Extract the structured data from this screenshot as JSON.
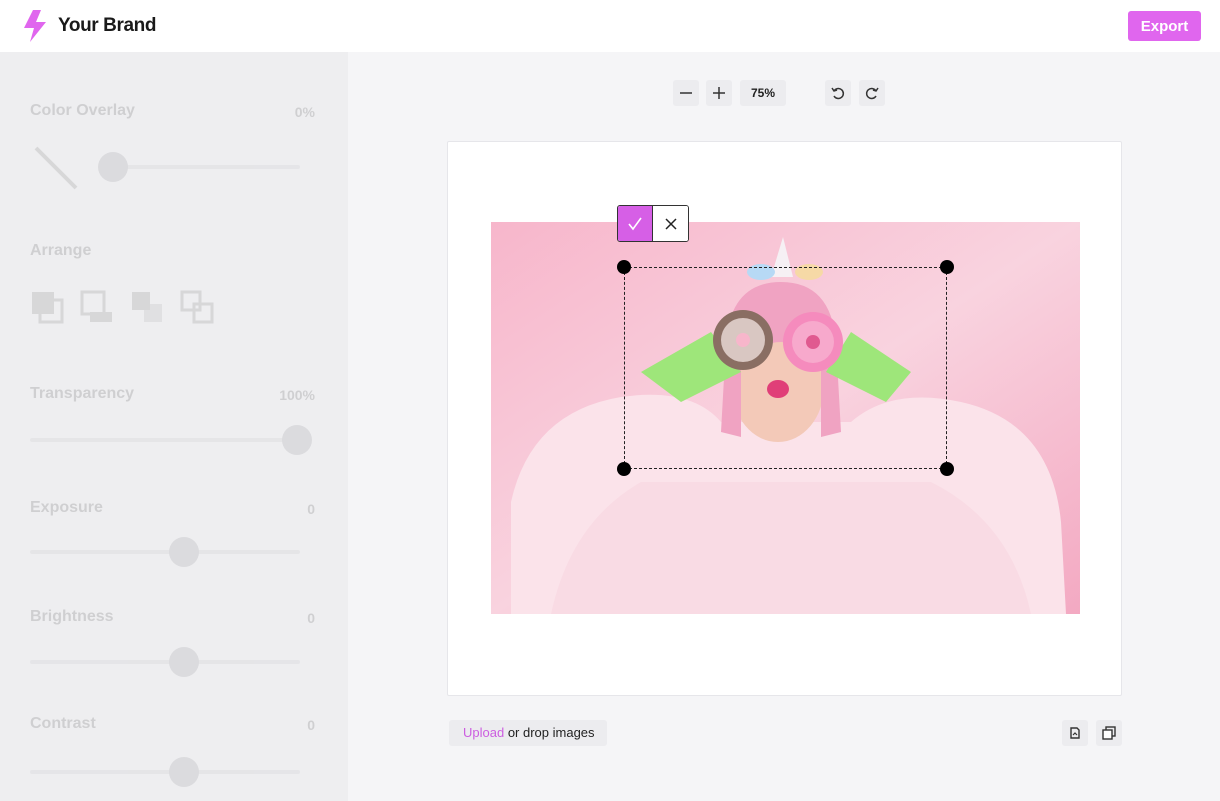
{
  "header": {
    "brand_name": "Your Brand",
    "export_label": "Export",
    "accent_color": "#e066ee"
  },
  "sidebar": {
    "color_overlay": {
      "label": "Color Overlay",
      "value": "0%"
    },
    "arrange": {
      "label": "Arrange",
      "icons": [
        "bring-to-front-icon",
        "send-to-back-icon",
        "bring-forward-icon",
        "send-backward-icon"
      ]
    },
    "transparency": {
      "label": "Transparency",
      "value": "100%"
    },
    "exposure": {
      "label": "Exposure",
      "value": "0"
    },
    "brightness": {
      "label": "Brightness",
      "value": "0"
    },
    "contrast": {
      "label": "Contrast",
      "value": "0"
    }
  },
  "toolbar": {
    "zoom_level": "75%",
    "icons": [
      "zoom-out-icon",
      "zoom-in-icon",
      "undo-icon",
      "redo-icon"
    ]
  },
  "crop": {
    "confirm_icon": "check-icon",
    "cancel_icon": "close-icon"
  },
  "upload": {
    "link_label": "Upload",
    "rest_label": " or drop images"
  },
  "bottom_icons": [
    "replace-image-icon",
    "duplicate-icon"
  ]
}
